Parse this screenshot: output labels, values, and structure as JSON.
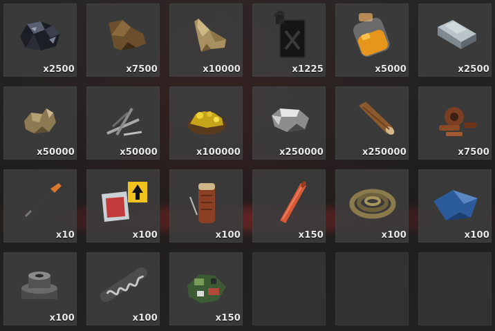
{
  "inventory": {
    "slots": [
      {
        "item": "coal-icon",
        "qty": "x2500"
      },
      {
        "item": "leather-icon",
        "qty": "x7500"
      },
      {
        "item": "cloth-icon",
        "qty": "x10000"
      },
      {
        "item": "fuel-can-icon",
        "qty": "x1225"
      },
      {
        "item": "sulfur-jar-icon",
        "qty": "x5000"
      },
      {
        "item": "metal-ingot-icon",
        "qty": "x2500"
      },
      {
        "item": "bone-fragments-icon",
        "qty": "x50000"
      },
      {
        "item": "sticks-icon",
        "qty": "x50000"
      },
      {
        "item": "gold-ore-icon",
        "qty": "x100000"
      },
      {
        "item": "stone-icon",
        "qty": "x250000"
      },
      {
        "item": "wood-log-icon",
        "qty": "x250000"
      },
      {
        "item": "scrap-gears-icon",
        "qty": "x7500"
      },
      {
        "item": "tech-blade-icon",
        "qty": "x10"
      },
      {
        "item": "road-signs-icon",
        "qty": "x100"
      },
      {
        "item": "sewing-kit-icon",
        "qty": "x100"
      },
      {
        "item": "metal-pipe-icon",
        "qty": "x150"
      },
      {
        "item": "rope-icon",
        "qty": "x100"
      },
      {
        "item": "tarp-icon",
        "qty": "x100"
      },
      {
        "item": "gears-icon",
        "qty": "x100"
      },
      {
        "item": "metal-spring-icon",
        "qty": "x100"
      },
      {
        "item": "scrap-components-icon",
        "qty": "x150"
      },
      {
        "item": "",
        "qty": ""
      },
      {
        "item": "",
        "qty": ""
      },
      {
        "item": "",
        "qty": ""
      }
    ]
  }
}
